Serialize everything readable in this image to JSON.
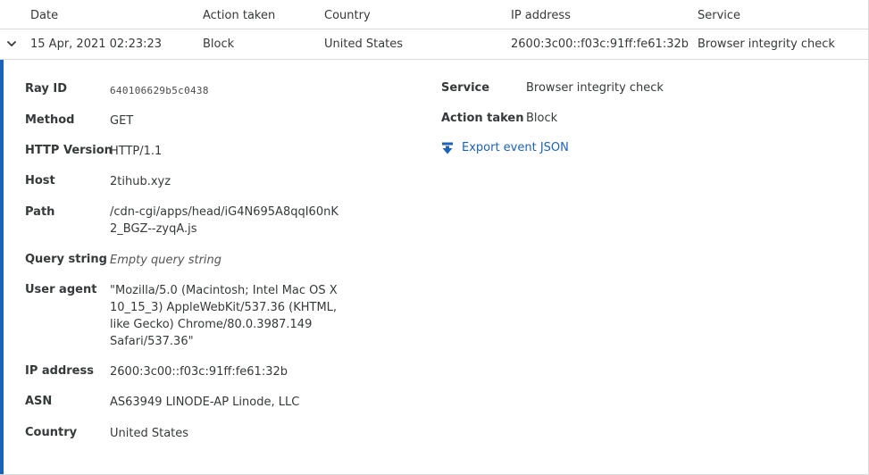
{
  "table": {
    "headers": {
      "date": "Date",
      "action": "Action taken",
      "country": "Country",
      "ip": "IP address",
      "service": "Service"
    },
    "row": {
      "date": "15 Apr, 2021 02:23:23",
      "action": "Block",
      "country": "United States",
      "ip": "2600:3c00::f03c:91ff:fe61:32b",
      "service": "Browser integrity check",
      "expand_icon": "chevron-down-icon"
    }
  },
  "details": {
    "ray_id": {
      "label": "Ray ID",
      "value": "640106629b5c0438"
    },
    "method": {
      "label": "Method",
      "value": "GET"
    },
    "http_version": {
      "label": "HTTP Version",
      "value": "HTTP/1.1"
    },
    "host": {
      "label": "Host",
      "value": "2tihub.xyz"
    },
    "path": {
      "label": "Path",
      "line1": "/cdn-cgi/apps/head/iG4N695A8qqI60nK",
      "line2": "2_BGZ--zyqA.js"
    },
    "query_string": {
      "label": "Query string",
      "value": "Empty query string"
    },
    "user_agent": {
      "label": "User agent",
      "lines": [
        "\"Mozilla/5.0 (Macintosh; Intel Mac OS X",
        "10_15_3) AppleWebKit/537.36 (KHTML,",
        "like Gecko) Chrome/80.0.3987.149",
        "Safari/537.36\""
      ]
    },
    "ip_address": {
      "label": "IP address",
      "value": "2600:3c00::f03c:91ff:fe61:32b"
    },
    "asn": {
      "label": "ASN",
      "value": "AS63949 LINODE-AP Linode, LLC"
    },
    "country": {
      "label": "Country",
      "value": "United States"
    },
    "service": {
      "label": "Service",
      "value": "Browser integrity check"
    },
    "action_taken": {
      "label": "Action taken",
      "value": "Block"
    },
    "export": {
      "label": "Export event JSON",
      "icon": "download-arrow-icon"
    }
  },
  "colors": {
    "accent": "#1d62b4",
    "border": "#d9d9d9",
    "text": "#36393a"
  }
}
